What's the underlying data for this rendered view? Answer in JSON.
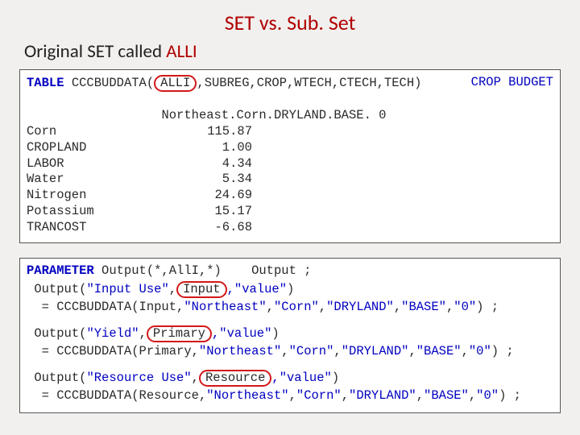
{
  "title": "SET vs. Sub. Set",
  "subtitle_prefix": "Original SET called  ",
  "subtitle_key": "ALLI",
  "box1": {
    "table_kw": "TABLE",
    "table_name": "CCCBUDDATA",
    "alli": "ALLI",
    "rest_sig": "SUBREG,CROP,WTECH,CTECH,TECH)",
    "right_label": "CROP BUDGET",
    "heading": "Northeast.Corn.DRYLAND.BASE. 0",
    "rows": [
      {
        "label": "Corn",
        "value": "115.87"
      },
      {
        "label": "CROPLAND",
        "value": "1.00"
      },
      {
        "label": "LABOR",
        "value": "4.34"
      },
      {
        "label": "Water",
        "value": "5.34"
      },
      {
        "label": "Nitrogen",
        "value": "24.69"
      },
      {
        "label": "Potassium",
        "value": "15.17"
      },
      {
        "label": "TRANCOST",
        "value": "-6.68"
      }
    ]
  },
  "box2": {
    "param_kw": "PARAMETER",
    "param_decl_a": " Output(*,",
    "param_decl_key": "AllI",
    "param_decl_b": ",*)    Output ;",
    "groups": [
      {
        "lhs_a": " Output(",
        "q1": "\"Input Use\"",
        "mid": ",",
        "circ": "Input",
        "q2": ",\"value\"",
        "lhs_b": ")",
        "rhs": "  = CCCBUDDATA(Input,\"Northeast\",\"Corn\",\"DRYLAND\",\"BASE\",\"0\") ;"
      },
      {
        "lhs_a": " Output(",
        "q1": "\"Yield\"",
        "mid": ",",
        "circ": "Primary",
        "q2": ",\"value\"",
        "lhs_b": ")",
        "rhs": "  = CCCBUDDATA(Primary,\"Northeast\",\"Corn\",\"DRYLAND\",\"BASE\",\"0\") ;"
      },
      {
        "lhs_a": " Output(",
        "q1": "\"Resource Use\"",
        "mid": ",",
        "circ": "Resource",
        "q2": ",\"value\"",
        "lhs_b": ")",
        "rhs": "  = CCCBUDDATA(Resource,\"Northeast\",\"Corn\",\"DRYLAND\",\"BASE\",\"0\") ;"
      }
    ]
  }
}
